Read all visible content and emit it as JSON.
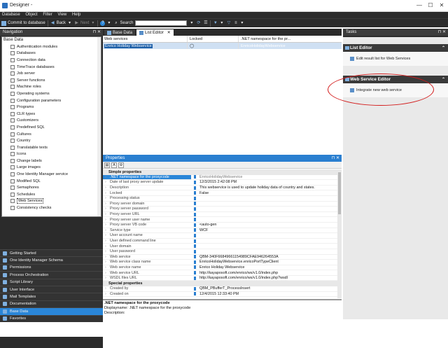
{
  "window": {
    "title": "Designer - ",
    "controls": [
      "—",
      "☐",
      "✕"
    ]
  },
  "menu": [
    "Database",
    "Object",
    "Filter",
    "View",
    "Help"
  ],
  "toolbar": {
    "commit": "Commit to database",
    "back": "Back",
    "next": "Next",
    "search": "Search"
  },
  "navigation": {
    "title": "Navigation",
    "root": "Base Data",
    "items": [
      "Authentication modules",
      "Databases",
      "Connection data",
      "TimeTrace databases",
      "Job server",
      "Server functions",
      "Machine roles",
      "Operating systems",
      "Configuration parameters",
      "Programs",
      "CLR types",
      "Customizers",
      "Predefined SQL",
      "Cultures",
      "Country",
      "Translatable texts",
      "Icons",
      "Change labels",
      "Large images",
      "One Identity Manager service",
      "Modified SQL",
      "Semaphores",
      "Schedules",
      "Web Services",
      "Consistency checks"
    ],
    "selected": "Web Services",
    "buttons": [
      "Getting Started",
      "One Identity Manager Schema",
      "Permissions",
      "Process Orchestration",
      "Script Library",
      "User Interface",
      "Mail Templates",
      "Documentation",
      "Base Data",
      "Favorites"
    ],
    "active_button": "Base Data"
  },
  "tabs": [
    "Base Data",
    "List Editor"
  ],
  "list": {
    "columns": [
      "Web services",
      "Locked",
      ".NET namespace for the pr..."
    ],
    "rows": [
      {
        "name": "Enrico Holiday Webservice",
        "locked": "◯",
        "ns": "EnricoHolidayWebservice"
      }
    ]
  },
  "properties": {
    "title": "Properties",
    "groups": [
      {
        "name": "Simple properties",
        "rows": [
          [
            ".NET namespace for the proxycode",
            "EnricoHolidayWebservice"
          ],
          [
            "Date of last proxy server update",
            "12/3/2015 2:42:08 PM"
          ],
          [
            "Description",
            "This webservice is used to update holiday data of country and states."
          ],
          [
            "Locked",
            "False"
          ],
          [
            "Processing status",
            ""
          ],
          [
            "Proxy server domain",
            ""
          ],
          [
            "Proxy server password",
            ""
          ],
          [
            "Proxy server URL",
            ""
          ],
          [
            "Proxy server user name",
            ""
          ],
          [
            "Proxy server VB code",
            "                                                          <auto-gen"
          ],
          [
            "Service type",
            "WCF"
          ],
          [
            "User account name",
            ""
          ],
          [
            "User defined command line",
            ""
          ],
          [
            "User domain",
            ""
          ],
          [
            "User password",
            ""
          ],
          [
            "Web service",
            "QBM-340F66849661154989CFAE946264553A"
          ],
          [
            "Web service class name",
            "EnricoHolidayWebservice.enricoPortTypeClient"
          ],
          [
            "Web service name",
            "Enrico Holiday Webservice"
          ],
          [
            "Web service URL",
            "http://kayaposoft.com/enrico/ws/v1.0/index.php"
          ],
          [
            "WSDL files URL",
            "http://kayaposoft.com/enrico/ws/v1.0/index.php?wsdl"
          ]
        ]
      },
      {
        "name": "Special properties",
        "rows": [
          [
            "Created by",
            "QBM_PBufferT_ProcessInsert"
          ],
          [
            "Created on",
            "12/4/2015 12:33:40 PM"
          ]
        ]
      }
    ],
    "desc_title": ".NET namespace for the proxycode",
    "desc_display": "Displayname: .NET namespace for the proxycode",
    "desc_label": "Description:"
  },
  "tasks": {
    "title": "Tasks",
    "sections": [
      {
        "title": "List Editor",
        "link": "Edit result list for Web Services"
      },
      {
        "title": "Web Service Editor",
        "link": "Integrate new web service"
      }
    ]
  },
  "colors": {
    "dark": "#2b2b2b",
    "accent": "#2a86d8",
    "highlight": "#d31c1c"
  }
}
